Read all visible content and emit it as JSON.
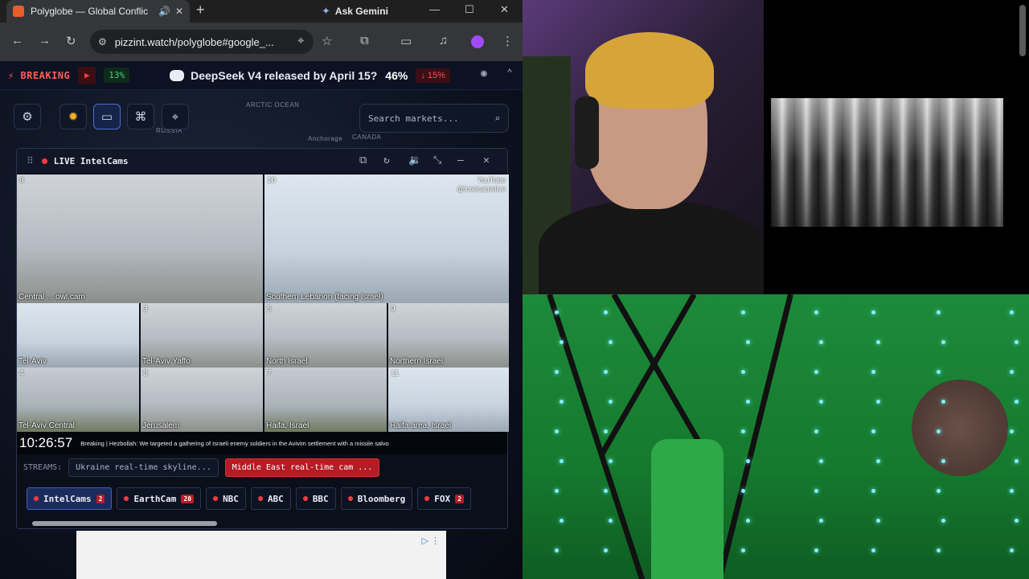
{
  "browser": {
    "tab_title": "Polyglobe — Global Conflic",
    "gemini_label": "Ask Gemini",
    "url": "pizzint.watch/polyglobe#google_..."
  },
  "breaking": {
    "label": "BREAKING",
    "pct_up": "13%",
    "market_question": "DeepSeek V4 released by April 15?",
    "market_value": "46%",
    "market_change": "↓ 15%"
  },
  "map": {
    "labels": [
      "ARCTIC OCEAN",
      "RUSSIA",
      "Anchorage",
      "CANADA"
    ],
    "search_placeholder": "Search markets..."
  },
  "widget": {
    "title": "LIVE IntelCams",
    "cams": [
      {
        "num": "8",
        "caption": "Central ... owl.cam"
      },
      {
        "num": "10",
        "caption": "Southern Lebanon (facing Israel)",
        "overlay": "YouTube\n@intelcamslive"
      },
      {
        "num": "",
        "caption": "Tel-Aviv"
      },
      {
        "num": "3",
        "caption": "Tel-Aviv Yaffo"
      },
      {
        "num": "5",
        "caption": "North Israel"
      },
      {
        "num": "9",
        "caption": "Northern Israel"
      },
      {
        "num": "4",
        "caption": "Tel-Aviv Central"
      },
      {
        "num": "6",
        "caption": "Jerusalem"
      },
      {
        "num": "7",
        "caption": "Haifa, Israel"
      },
      {
        "num": "11",
        "caption": "Haifa area, Israel"
      }
    ],
    "clock": "10:26:57",
    "news": "Breaking | Hezbollah: We targeted a gathering of Israeli enemy soldiers in the Avivim settlement with a missile salvo",
    "streams_label": "STREAMS:",
    "streams": [
      "Ukraine real-time skyline...",
      "Middle East real-time cam ..."
    ],
    "channels": [
      {
        "name": "IntelCams",
        "count": "2"
      },
      {
        "name": "EarthCam",
        "count": "20"
      },
      {
        "name": "NBC",
        "count": ""
      },
      {
        "name": "ABC",
        "count": ""
      },
      {
        "name": "BBC",
        "count": ""
      },
      {
        "name": "Bloomberg",
        "count": ""
      },
      {
        "name": "FOX",
        "count": "2"
      }
    ]
  },
  "colors": {
    "accent_red": "#b61c24",
    "positive": "#43d17a",
    "negative": "#ff4d5a",
    "panel": "#0b0f19"
  }
}
